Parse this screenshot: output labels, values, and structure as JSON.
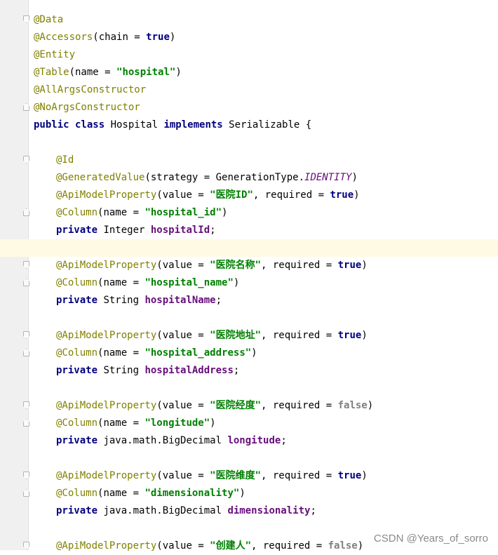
{
  "watermark": "CSDN @Years_of_sorro",
  "lines": [
    {
      "fold": "open",
      "tokens": [
        [
          "ann",
          "@Data"
        ]
      ]
    },
    {
      "tokens": [
        [
          "ann",
          "@Accessors"
        ],
        [
          "plain",
          "(chain = "
        ],
        [
          "lit",
          "true"
        ],
        [
          "plain",
          ")"
        ]
      ]
    },
    {
      "tokens": [
        [
          "ann",
          "@Entity"
        ]
      ]
    },
    {
      "tokens": [
        [
          "ann",
          "@Table"
        ],
        [
          "plain",
          "(name = "
        ],
        [
          "str",
          "\"hospital\""
        ],
        [
          "plain",
          ")"
        ]
      ]
    },
    {
      "tokens": [
        [
          "ann",
          "@AllArgsConstructor"
        ]
      ]
    },
    {
      "fold": "close",
      "tokens": [
        [
          "ann",
          "@NoArgsConstructor"
        ]
      ]
    },
    {
      "tokens": [
        [
          "kw",
          "public class "
        ],
        [
          "plain",
          "Hospital "
        ],
        [
          "kw",
          "implements "
        ],
        [
          "plain",
          "Serializable {"
        ]
      ]
    },
    {
      "tokens": []
    },
    {
      "fold": "open",
      "indent": true,
      "tokens": [
        [
          "ann",
          "@Id"
        ]
      ]
    },
    {
      "indent": true,
      "tokens": [
        [
          "ann",
          "@GeneratedValue"
        ],
        [
          "plain",
          "(strategy = GenerationType."
        ],
        [
          "stat",
          "IDENTITY"
        ],
        [
          "plain",
          ")"
        ]
      ]
    },
    {
      "indent": true,
      "tokens": [
        [
          "ann",
          "@ApiModelProperty"
        ],
        [
          "plain",
          "(value = "
        ],
        [
          "str",
          "\"医院ID\""
        ],
        [
          "plain",
          ", required = "
        ],
        [
          "lit",
          "true"
        ],
        [
          "plain",
          ")"
        ]
      ]
    },
    {
      "fold": "close",
      "indent": true,
      "tokens": [
        [
          "ann",
          "@Column"
        ],
        [
          "plain",
          "(name = "
        ],
        [
          "str",
          "\"hospital_id\""
        ],
        [
          "plain",
          ")"
        ]
      ]
    },
    {
      "indent": true,
      "tokens": [
        [
          "kw",
          "private "
        ],
        [
          "plain",
          "Integer "
        ],
        [
          "fld",
          "hospitalId"
        ],
        [
          "plain",
          ";"
        ]
      ]
    },
    {
      "current": true,
      "tokens": []
    },
    {
      "fold": "open",
      "indent": true,
      "tokens": [
        [
          "ann",
          "@ApiModelProperty"
        ],
        [
          "plain",
          "(value = "
        ],
        [
          "str",
          "\"医院名称\""
        ],
        [
          "plain",
          ", required = "
        ],
        [
          "lit",
          "true"
        ],
        [
          "plain",
          ")"
        ]
      ]
    },
    {
      "fold": "close",
      "indent": true,
      "tokens": [
        [
          "ann",
          "@Column"
        ],
        [
          "plain",
          "(name = "
        ],
        [
          "str",
          "\"hospital_name\""
        ],
        [
          "plain",
          ")"
        ]
      ]
    },
    {
      "indent": true,
      "tokens": [
        [
          "kw",
          "private "
        ],
        [
          "plain",
          "String "
        ],
        [
          "fld",
          "hospitalName"
        ],
        [
          "plain",
          ";"
        ]
      ]
    },
    {
      "tokens": []
    },
    {
      "fold": "open",
      "indent": true,
      "tokens": [
        [
          "ann",
          "@ApiModelProperty"
        ],
        [
          "plain",
          "(value = "
        ],
        [
          "str",
          "\"医院地址\""
        ],
        [
          "plain",
          ", required = "
        ],
        [
          "lit",
          "true"
        ],
        [
          "plain",
          ")"
        ]
      ]
    },
    {
      "fold": "close",
      "indent": true,
      "tokens": [
        [
          "ann",
          "@Column"
        ],
        [
          "plain",
          "(name = "
        ],
        [
          "str",
          "\"hospital_address\""
        ],
        [
          "plain",
          ")"
        ]
      ]
    },
    {
      "indent": true,
      "tokens": [
        [
          "kw",
          "private "
        ],
        [
          "plain",
          "String "
        ],
        [
          "fld",
          "hospitalAddress"
        ],
        [
          "plain",
          ";"
        ]
      ]
    },
    {
      "tokens": []
    },
    {
      "fold": "open",
      "indent": true,
      "tokens": [
        [
          "ann",
          "@ApiModelProperty"
        ],
        [
          "plain",
          "(value = "
        ],
        [
          "str",
          "\"医院经度\""
        ],
        [
          "plain",
          ", required = "
        ],
        [
          "lit-false",
          "false"
        ],
        [
          "plain",
          ")"
        ]
      ]
    },
    {
      "fold": "close",
      "indent": true,
      "tokens": [
        [
          "ann",
          "@Column"
        ],
        [
          "plain",
          "(name = "
        ],
        [
          "str",
          "\"longitude\""
        ],
        [
          "plain",
          ")"
        ]
      ]
    },
    {
      "indent": true,
      "tokens": [
        [
          "kw",
          "private "
        ],
        [
          "plain",
          "java.math.BigDecimal "
        ],
        [
          "fld",
          "longitude"
        ],
        [
          "plain",
          ";"
        ]
      ]
    },
    {
      "tokens": []
    },
    {
      "fold": "open",
      "indent": true,
      "tokens": [
        [
          "ann",
          "@ApiModelProperty"
        ],
        [
          "plain",
          "(value = "
        ],
        [
          "str",
          "\"医院维度\""
        ],
        [
          "plain",
          ", required = "
        ],
        [
          "lit",
          "true"
        ],
        [
          "plain",
          ")"
        ]
      ]
    },
    {
      "fold": "close",
      "indent": true,
      "tokens": [
        [
          "ann",
          "@Column"
        ],
        [
          "plain",
          "(name = "
        ],
        [
          "str",
          "\"dimensionality\""
        ],
        [
          "plain",
          ")"
        ]
      ]
    },
    {
      "indent": true,
      "tokens": [
        [
          "kw",
          "private "
        ],
        [
          "plain",
          "java.math.BigDecimal "
        ],
        [
          "fld",
          "dimensionality"
        ],
        [
          "plain",
          ";"
        ]
      ]
    },
    {
      "tokens": []
    },
    {
      "fold": "open",
      "indent": true,
      "tokens": [
        [
          "ann",
          "@ApiModelProperty"
        ],
        [
          "plain",
          "(value = "
        ],
        [
          "str",
          "\"创建人\""
        ],
        [
          "plain",
          ", required = "
        ],
        [
          "lit-false",
          "false"
        ],
        [
          "plain",
          ")"
        ]
      ]
    }
  ]
}
